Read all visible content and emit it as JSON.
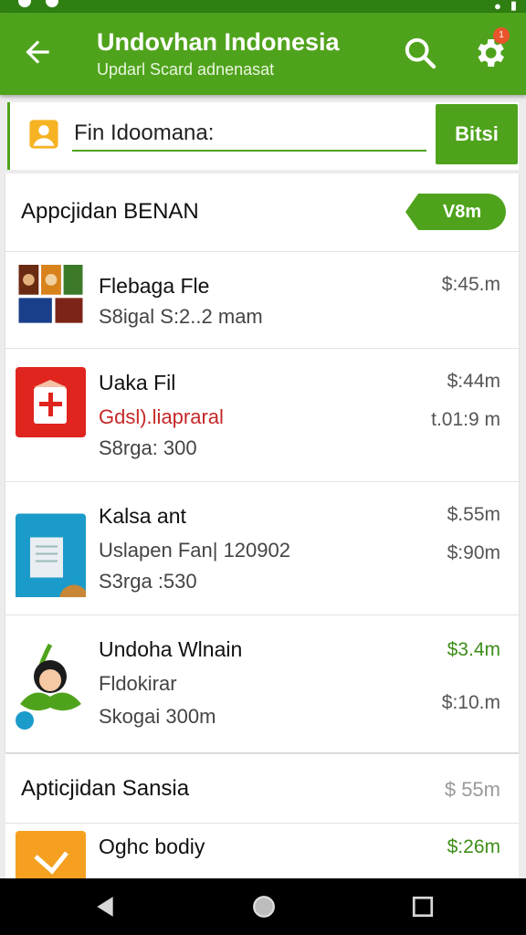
{
  "appbar": {
    "title": "Undovhan Indonesia",
    "subtitle": "Updarl Scard adnenasat",
    "icons": [
      "arrow-back-icon",
      "search-icon",
      "gear-icon"
    ],
    "badge": "1"
  },
  "search": {
    "value": "Fin Idoomana:",
    "button_label": "Bitsi"
  },
  "section1": {
    "title": "Appcjidan BENAN",
    "pill_label": "V8m"
  },
  "items": [
    {
      "name": "Flebaga Fle",
      "line1": "S8igal S:2..2 mam",
      "price1": "$:45.m"
    },
    {
      "name": "Uaka Fil",
      "line1": "Gdsl).liapraral",
      "line2": "S8rga: 300",
      "price1": "$:44m",
      "price2": "t.01:9 m"
    },
    {
      "name": "Kalsa ant",
      "line1": "Uslapen Fan| 120902",
      "line2": "S3rga :530",
      "price1": "$.55m",
      "price2": "$:90m"
    },
    {
      "name": "Undoha Wlnain",
      "line1": "Fldokirar",
      "line2": "Skogai 300m",
      "price1": "$3.4m",
      "price2": "$:10.m"
    }
  ],
  "section2": {
    "title": "Apticjidan Sansia",
    "price": "$ 55m"
  },
  "item5": {
    "name": "Oghc bodiy",
    "price1": "$:26m"
  },
  "colors": {
    "primary": "#4fa31c",
    "statusbar": "#2f7f12",
    "accent_red": "#c62828",
    "price_green": "#3e8e19"
  }
}
